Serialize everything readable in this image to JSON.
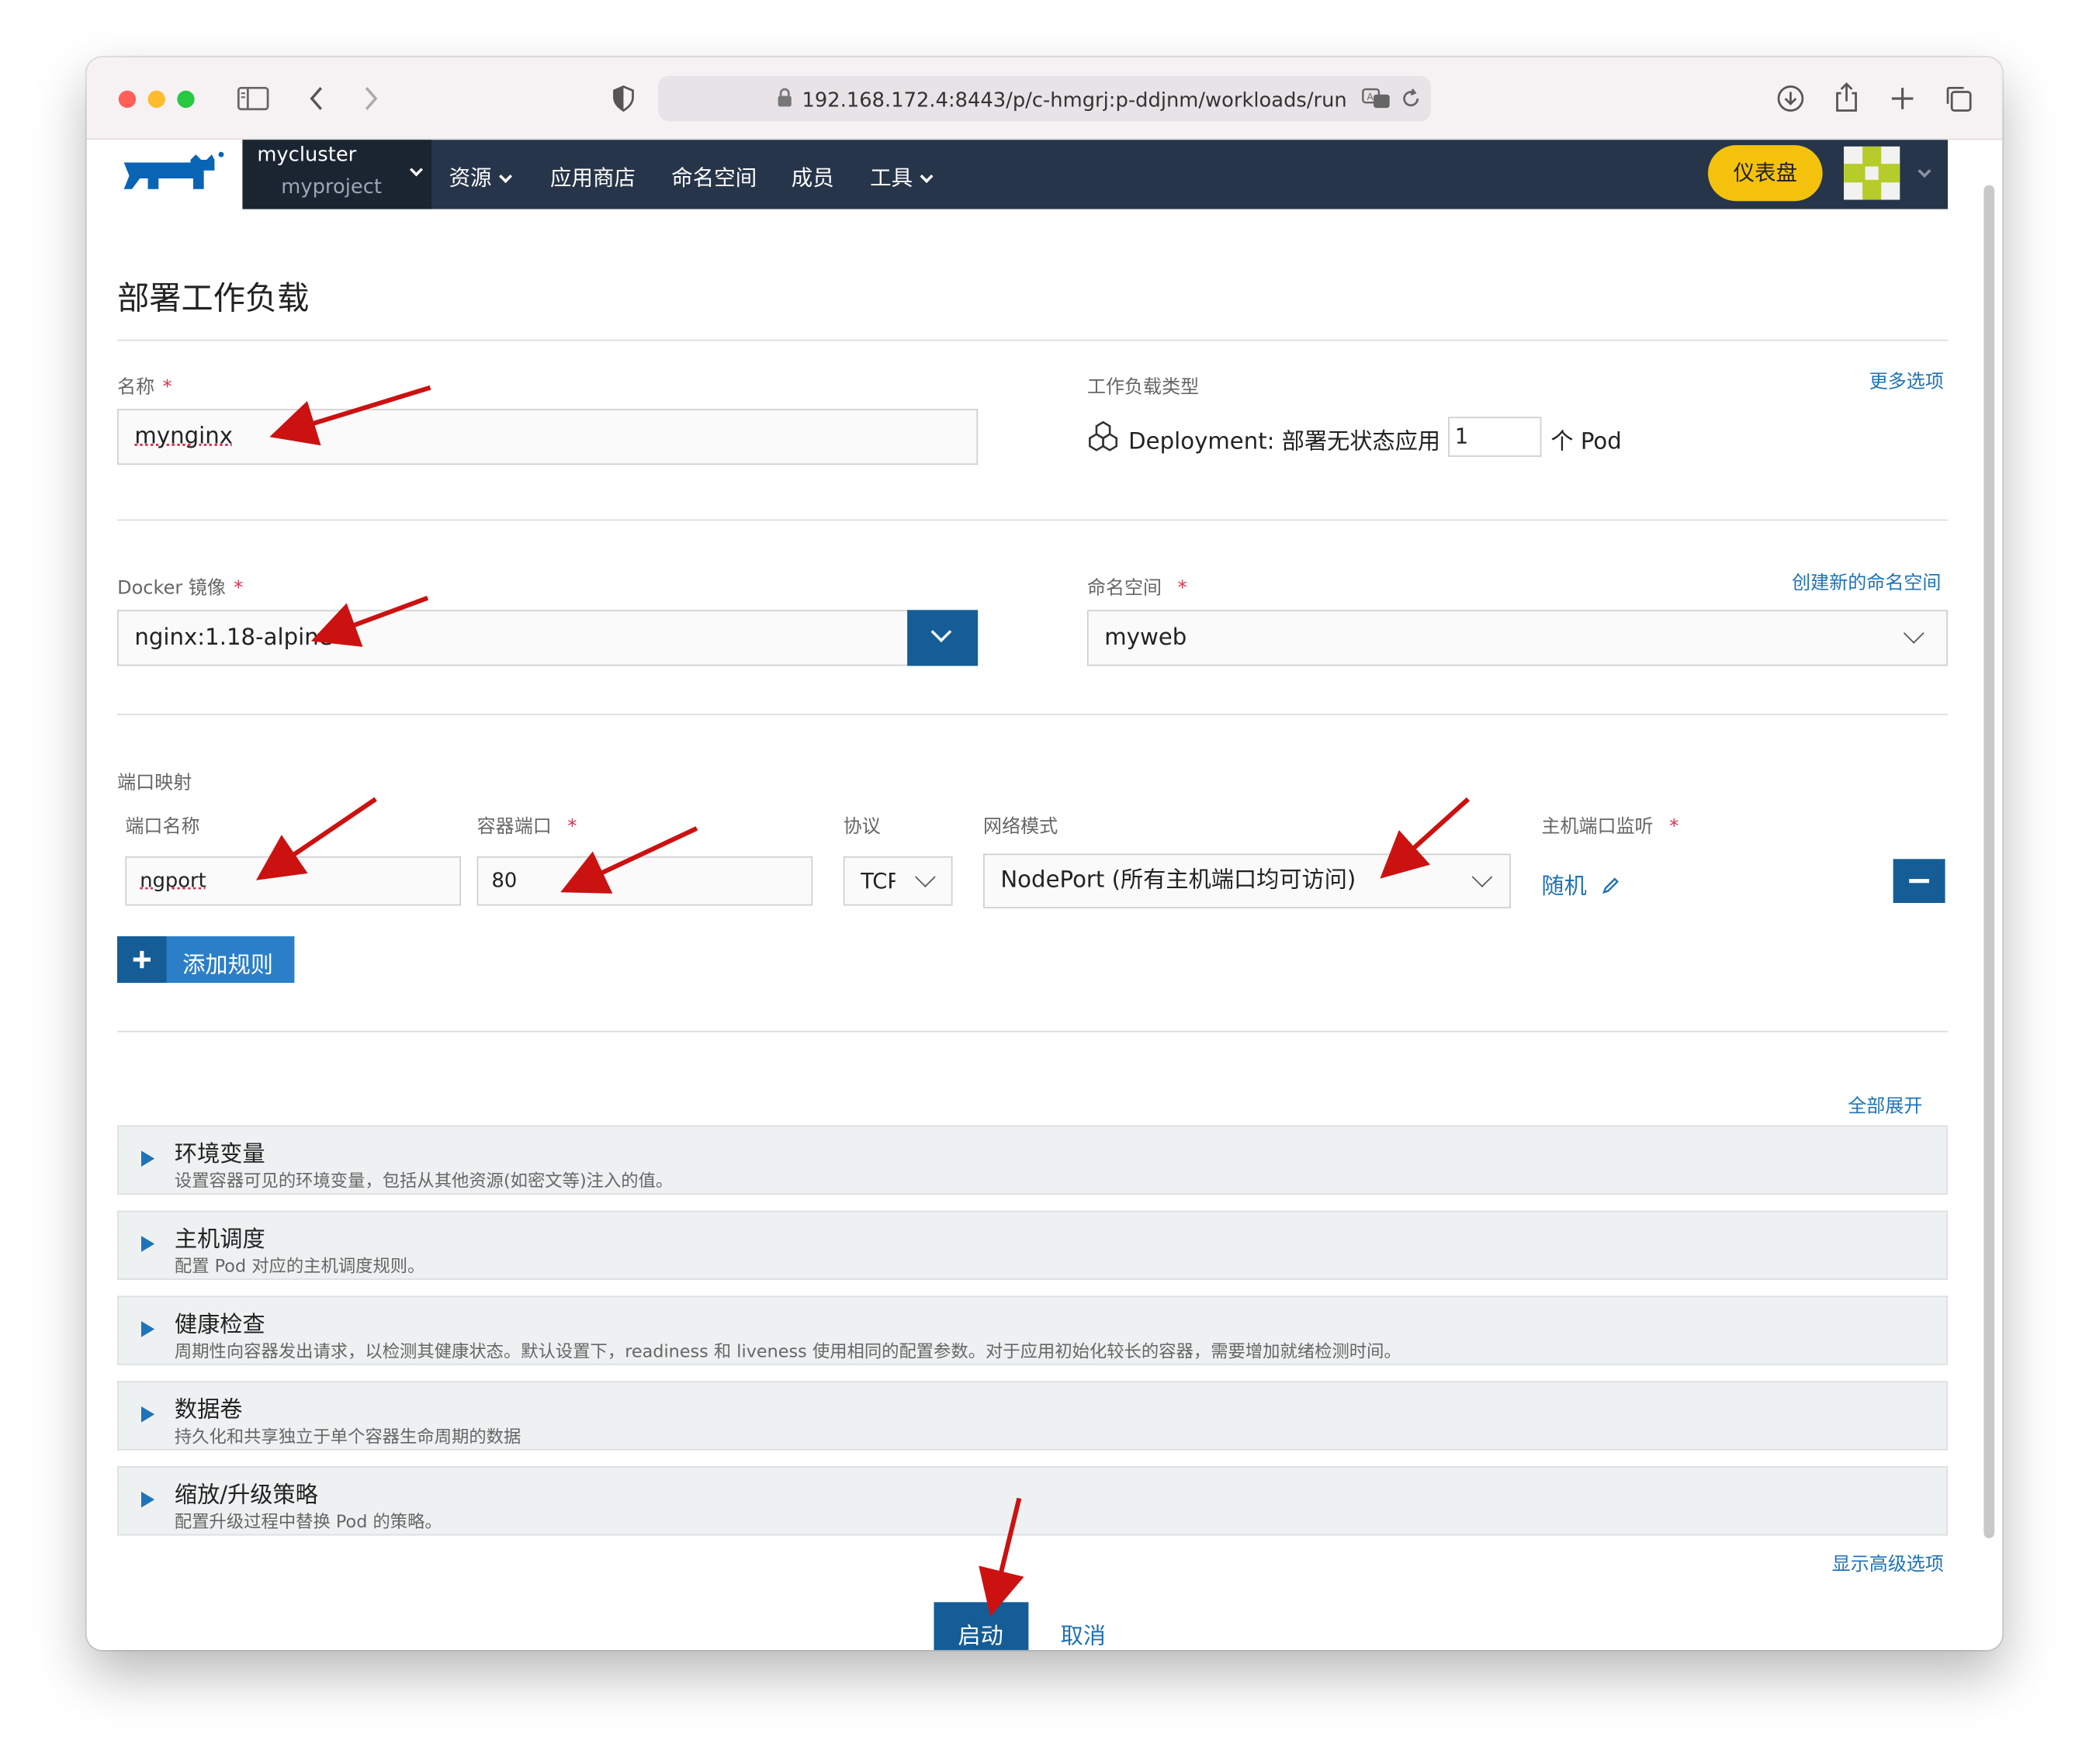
{
  "browser": {
    "url": "192.168.172.4:8443/p/c-hmgrj:p-ddjnm/workloads/run"
  },
  "nav": {
    "cluster": "mycluster",
    "project": "myproject",
    "items": [
      {
        "label": "资源"
      },
      {
        "label": "应用商店"
      },
      {
        "label": "命名空间"
      },
      {
        "label": "成员"
      },
      {
        "label": "工具"
      }
    ],
    "dashboard": "仪表盘"
  },
  "page": {
    "title": "部署工作负载"
  },
  "form": {
    "name_label": "名称",
    "name_value": "mynginx",
    "workload_type_label": "工作负载类型",
    "more_options": "更多选项",
    "workload_type_text": "Deployment: 部署无状态应用",
    "replicas": "1",
    "replicas_unit": "个 Pod",
    "docker_label": "Docker 镜像",
    "docker_value": "nginx:1.18-alpine",
    "namespace_label": "命名空间",
    "create_namespace": "创建新的命名空间",
    "namespace_value": "myweb",
    "required_mark": "*"
  },
  "ports": {
    "section_label": "端口映射",
    "col_name": "端口名称",
    "col_container_port": "容器端口",
    "col_protocol": "协议",
    "col_network_mode": "网络模式",
    "col_host_port": "主机端口监听",
    "row": {
      "name": "ngport",
      "container_port": "80",
      "protocol": "TCP",
      "network_mode": "NodePort (所有主机端口均可访问)",
      "host_port": "随机"
    },
    "add_rule": "添加规则"
  },
  "expand_all": "全部展开",
  "sections": [
    {
      "title": "环境变量",
      "desc": "设置容器可见的环境变量，包括从其他资源(如密文等)注入的值。"
    },
    {
      "title": "主机调度",
      "desc": "配置 Pod 对应的主机调度规则。"
    },
    {
      "title": "健康检查",
      "desc": "周期性向容器发出请求，以检测其健康状态。默认设置下，readiness 和 liveness 使用相同的配置参数。对于应用初始化较长的容器，需要增加就绪检测时间。"
    },
    {
      "title": "数据卷",
      "desc": "持久化和共享独立于单个容器生命周期的数据"
    },
    {
      "title": "缩放/升级策略",
      "desc": "配置升级过程中替换 Pod 的策略。"
    }
  ],
  "show_advanced": "显示高级选项",
  "actions": {
    "launch": "启动",
    "cancel": "取消"
  },
  "colors": {
    "nav_bg": "#27354a",
    "primary": "#155d97",
    "link": "#1f73b7",
    "dashboard_btn": "#f4c20d",
    "annotation_arrow": "#cc1111"
  }
}
